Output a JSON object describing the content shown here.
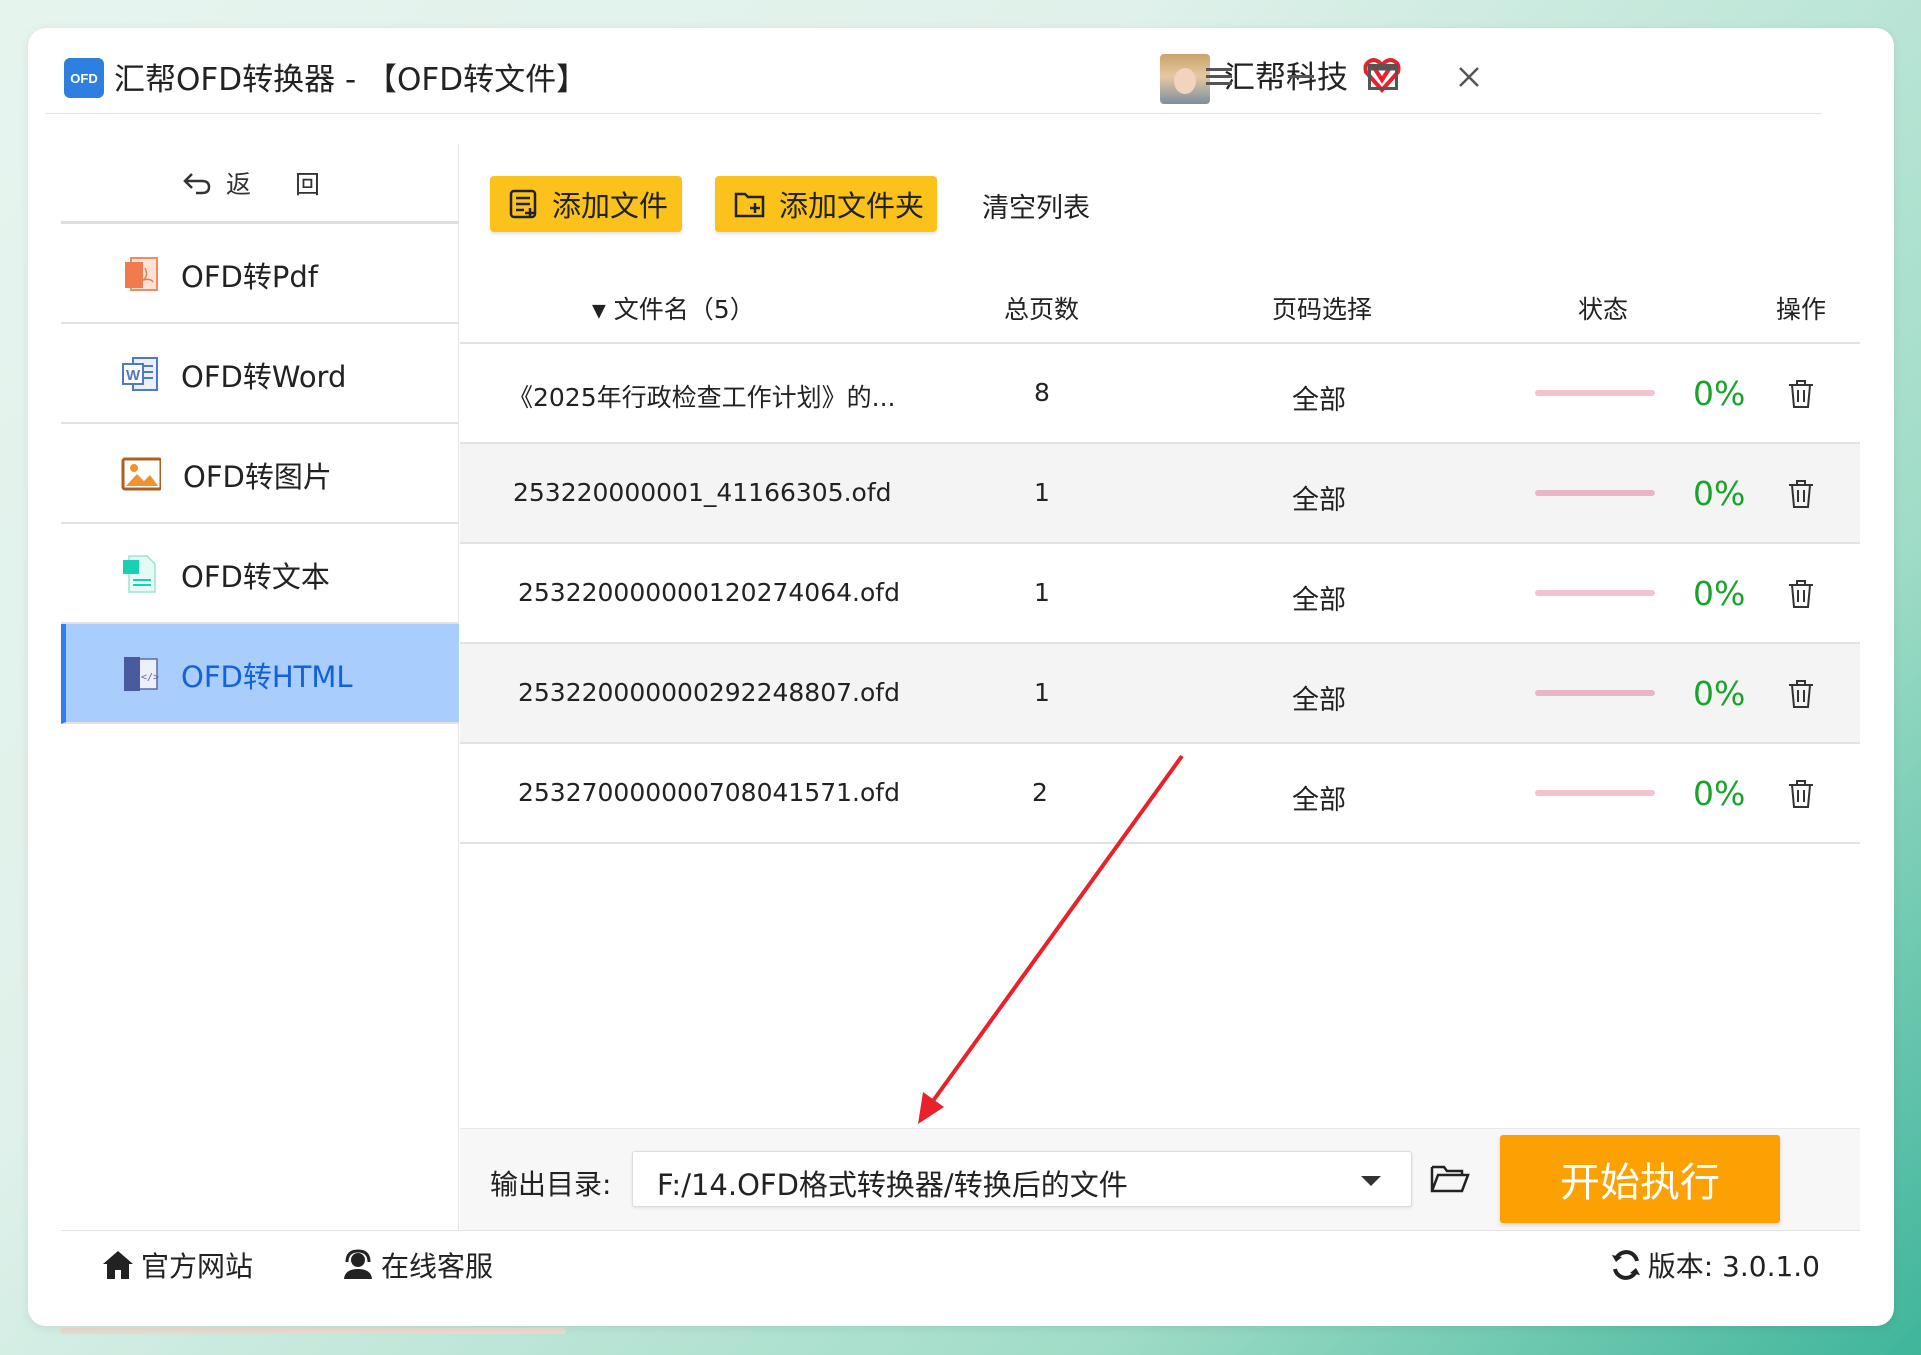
{
  "window": {
    "app_title": "汇帮OFD转换器 - 【OFD转文件】",
    "logo_text": "OFD",
    "company_name": "汇帮科技"
  },
  "sidebar": {
    "back_label": "返 回",
    "items": [
      {
        "label": "OFD转Pdf",
        "icon": "pdf-icon"
      },
      {
        "label": "OFD转Word",
        "icon": "word-icon"
      },
      {
        "label": "OFD转图片",
        "icon": "image-icon"
      },
      {
        "label": "OFD转文本",
        "icon": "text-file-icon"
      },
      {
        "label": "OFD转HTML",
        "icon": "html-file-icon",
        "active": true
      }
    ]
  },
  "toolbar": {
    "add_file_label": "添加文件",
    "add_folder_label": "添加文件夹",
    "clear_list_label": "清空列表"
  },
  "table": {
    "headers": {
      "filename": "文件名（5）",
      "total_pages": "总页数",
      "page_select": "页码选择",
      "status": "状态",
      "action": "操作"
    },
    "rows": [
      {
        "filename": "《2025年行政检查工作计划》的...",
        "pages": "8",
        "page_select": "全部",
        "progress": "0%"
      },
      {
        "filename": "253220000001_41166305.ofd",
        "pages": "1",
        "page_select": "全部",
        "progress": "0%"
      },
      {
        "filename": "253220000000120274064.ofd",
        "pages": "1",
        "page_select": "全部",
        "progress": "0%"
      },
      {
        "filename": "253220000000292248807.ofd",
        "pages": "1",
        "page_select": "全部",
        "progress": "0%"
      },
      {
        "filename": "253270000000708041571.ofd",
        "pages": "2",
        "page_select": "全部",
        "progress": "0%"
      }
    ]
  },
  "output": {
    "label": "输出目录:",
    "path": "F:/14.OFD格式转换器/转换后的文件",
    "start_label": "开始执行"
  },
  "footer": {
    "website_label": "官方网站",
    "support_label": "在线客服",
    "version_label": "版本: 3.0.1.0"
  },
  "colors": {
    "accent_yellow": "#fbc21c",
    "start_orange": "#fba103",
    "active_nav": "#a9cdfd",
    "progress_green": "#1aa32a",
    "arrow_red": "#e8222a"
  }
}
